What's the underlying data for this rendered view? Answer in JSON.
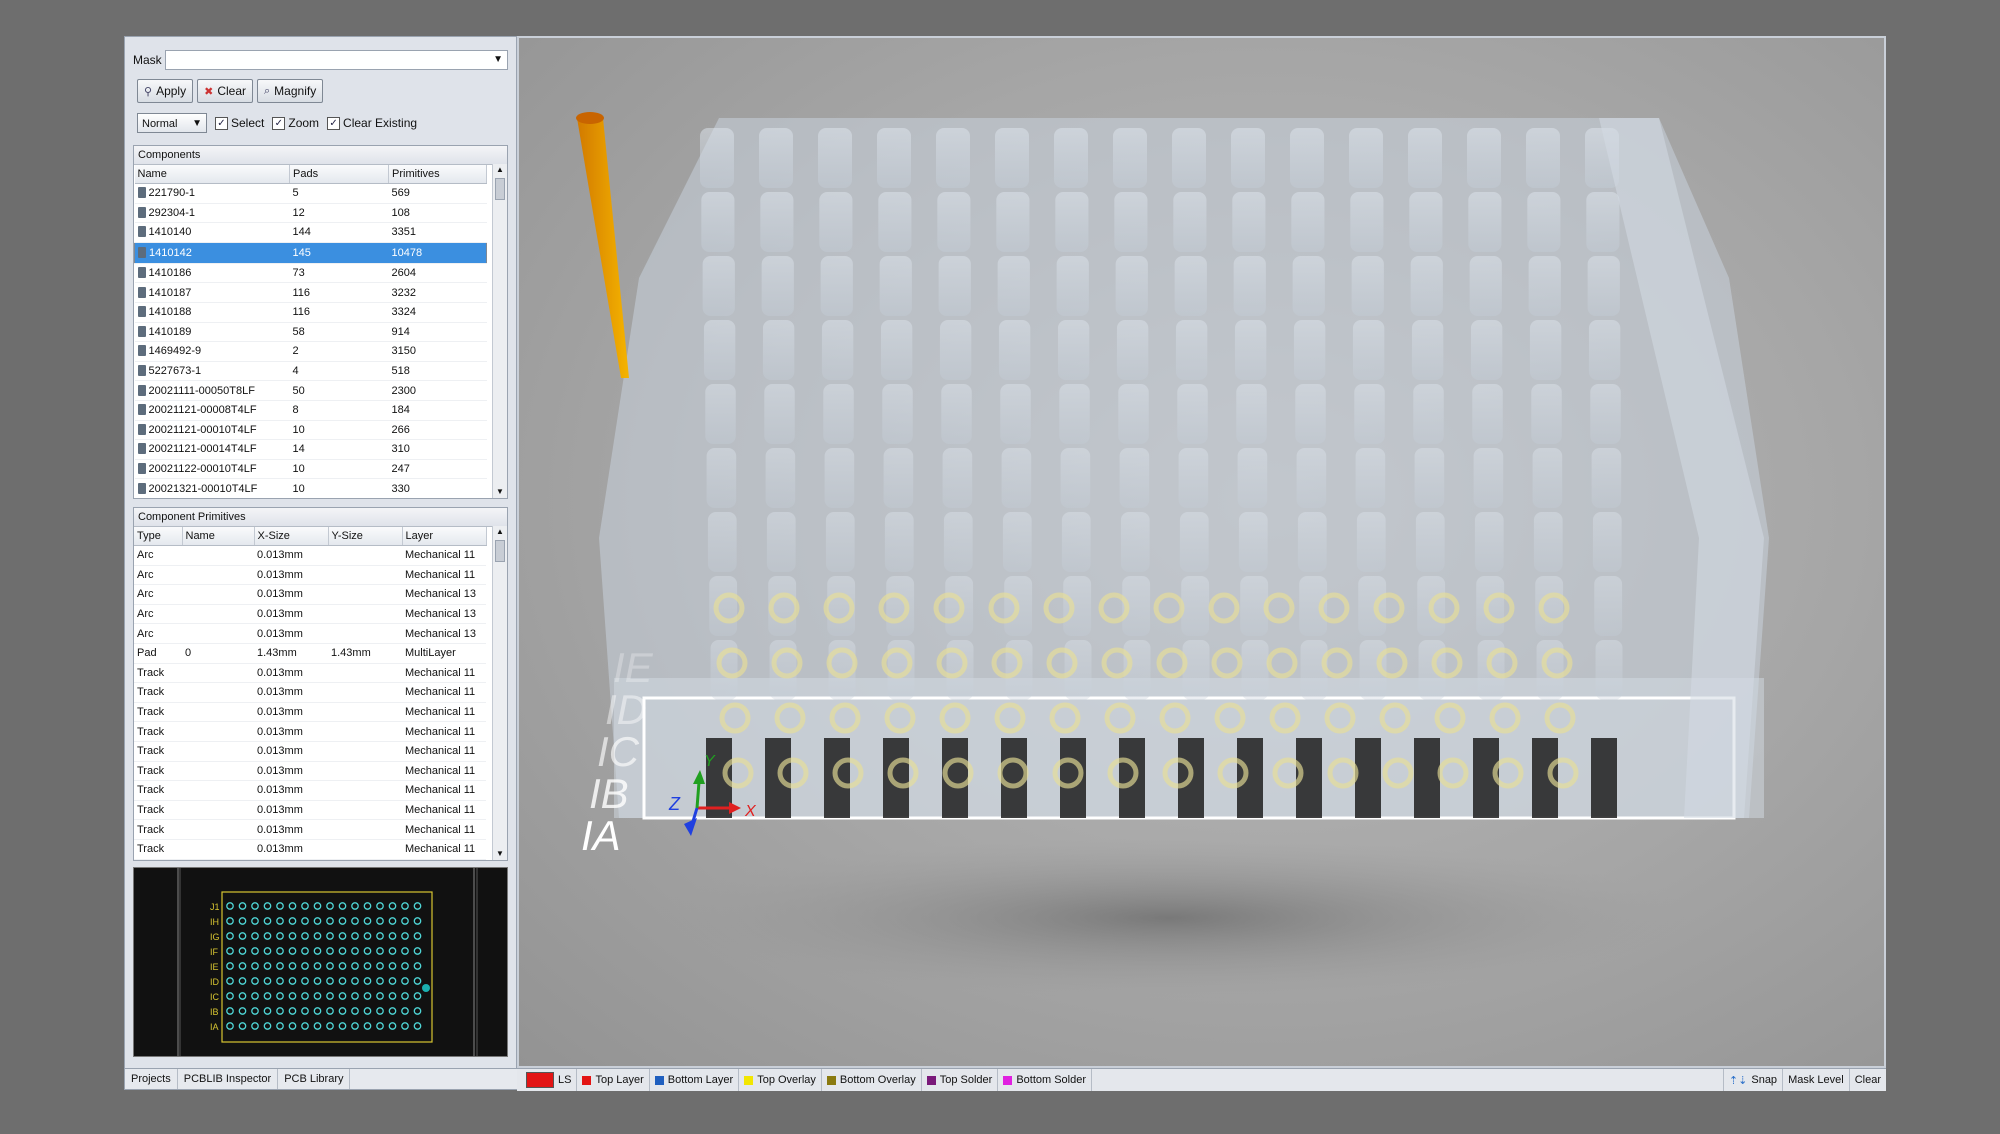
{
  "mask": {
    "label": "Mask",
    "value": ""
  },
  "buttons": {
    "apply": "Apply",
    "clear": "Clear",
    "magnify": "Magnify"
  },
  "options": {
    "mode": "Normal",
    "select": "Select",
    "zoom": "Zoom",
    "clear_existing": "Clear Existing",
    "select_checked": true,
    "zoom_checked": true,
    "clear_existing_checked": true
  },
  "components": {
    "title": "Components",
    "columns": [
      "Name",
      "Pads",
      "Primitives"
    ],
    "rows": [
      [
        "221790-1",
        "5",
        "569"
      ],
      [
        "292304-1",
        "12",
        "108"
      ],
      [
        "1410140",
        "144",
        "3351"
      ],
      [
        "1410142",
        "145",
        "10478"
      ],
      [
        "1410186",
        "73",
        "2604"
      ],
      [
        "1410187",
        "116",
        "3232"
      ],
      [
        "1410188",
        "116",
        "3324"
      ],
      [
        "1410189",
        "58",
        "914"
      ],
      [
        "1469492-9",
        "2",
        "3150"
      ],
      [
        "5227673-1",
        "4",
        "518"
      ],
      [
        "20021111-00050T8LF",
        "50",
        "2300"
      ],
      [
        "20021121-00008T4LF",
        "8",
        "184"
      ],
      [
        "20021121-00010T4LF",
        "10",
        "266"
      ],
      [
        "20021121-00014T4LF",
        "14",
        "310"
      ],
      [
        "20021122-00010T4LF",
        "10",
        "247"
      ],
      [
        "20021321-00010T4LF",
        "10",
        "330"
      ]
    ],
    "selected_index": 3
  },
  "primitives": {
    "title": "Component Primitives",
    "columns": [
      "Type",
      "Name",
      "X-Size",
      "Y-Size",
      "Layer"
    ],
    "rows": [
      [
        "Arc",
        "",
        "0.013mm",
        "",
        "Mechanical 11"
      ],
      [
        "Arc",
        "",
        "0.013mm",
        "",
        "Mechanical 11"
      ],
      [
        "Arc",
        "",
        "0.013mm",
        "",
        "Mechanical 13"
      ],
      [
        "Arc",
        "",
        "0.013mm",
        "",
        "Mechanical 13"
      ],
      [
        "Arc",
        "",
        "0.013mm",
        "",
        "Mechanical 13"
      ],
      [
        "Pad",
        "0",
        "1.43mm",
        "1.43mm",
        "MultiLayer"
      ],
      [
        "Track",
        "",
        "0.013mm",
        "",
        "Mechanical 11"
      ],
      [
        "Track",
        "",
        "0.013mm",
        "",
        "Mechanical 11"
      ],
      [
        "Track",
        "",
        "0.013mm",
        "",
        "Mechanical 11"
      ],
      [
        "Track",
        "",
        "0.013mm",
        "",
        "Mechanical 11"
      ],
      [
        "Track",
        "",
        "0.013mm",
        "",
        "Mechanical 11"
      ],
      [
        "Track",
        "",
        "0.013mm",
        "",
        "Mechanical 11"
      ],
      [
        "Track",
        "",
        "0.013mm",
        "",
        "Mechanical 11"
      ],
      [
        "Track",
        "",
        "0.013mm",
        "",
        "Mechanical 11"
      ],
      [
        "Track",
        "",
        "0.013mm",
        "",
        "Mechanical 11"
      ],
      [
        "Track",
        "",
        "0.013mm",
        "",
        "Mechanical 11"
      ]
    ]
  },
  "mini_rows": [
    "J1",
    "IH",
    "IG",
    "IF",
    "IE",
    "ID",
    "IC",
    "IB",
    "IA"
  ],
  "tabs": [
    "Projects",
    "PCBLIB Inspector",
    "PCB Library"
  ],
  "layers": [
    {
      "name": "Top Layer",
      "color": "#e31414"
    },
    {
      "name": "Bottom Layer",
      "color": "#1f5fbf"
    },
    {
      "name": "Top Overlay",
      "color": "#f2e600"
    },
    {
      "name": "Bottom Overlay",
      "color": "#8a7a10"
    },
    {
      "name": "Top Solder",
      "color": "#7a1a7a"
    },
    {
      "name": "Bottom Solder",
      "color": "#e020e0"
    }
  ],
  "status": {
    "layer_hint": "LS",
    "snap": "Snap",
    "mask_level": "Mask Level",
    "clear": "Clear"
  },
  "axes": {
    "x": "X",
    "y": "Y",
    "z": "Z"
  },
  "view_labels": [
    "IA",
    "IB",
    "IC",
    "ID",
    "IE"
  ]
}
